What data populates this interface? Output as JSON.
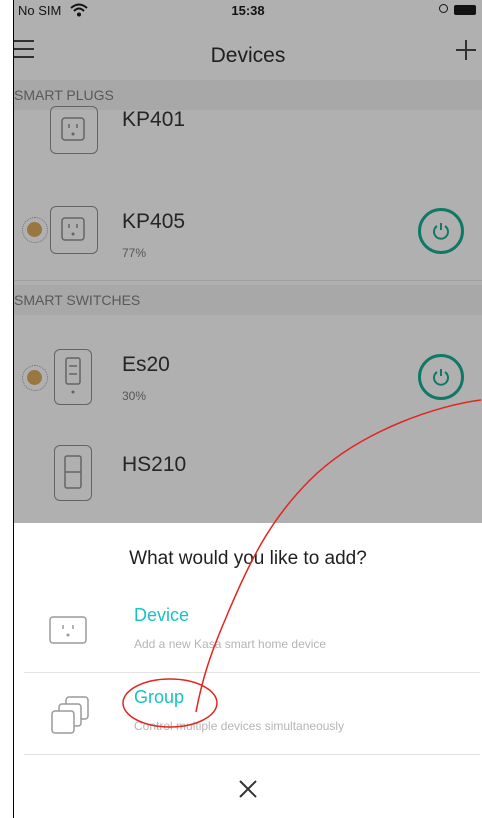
{
  "status_bar": {
    "carrier": "No SIM",
    "time": "15:38"
  },
  "header": {
    "title": "Devices"
  },
  "sections": [
    {
      "title": "SMART PLUGS"
    },
    {
      "title": "SMART SWITCHES"
    }
  ],
  "devices": [
    {
      "name": "KP401",
      "sub": ""
    },
    {
      "name": "KP405",
      "sub": "77%"
    },
    {
      "name": "Es20",
      "sub": "30%"
    },
    {
      "name": "HS210",
      "sub": ""
    }
  ],
  "sheet": {
    "title": "What would you like to add?",
    "options": [
      {
        "label": "Device",
        "description": "Add a new Kasa smart home device"
      },
      {
        "label": "Group",
        "description": "Control multiple devices simultaneously"
      }
    ]
  },
  "colors": {
    "accent": "#17c3c3",
    "power": "#1aa58c",
    "annotation": "#e0261d"
  },
  "icons": [
    "menu-icon",
    "add-icon",
    "plug-icon",
    "switch-icon",
    "power-icon",
    "group-icon",
    "close-icon",
    "wifi-icon",
    "battery-icon"
  ]
}
